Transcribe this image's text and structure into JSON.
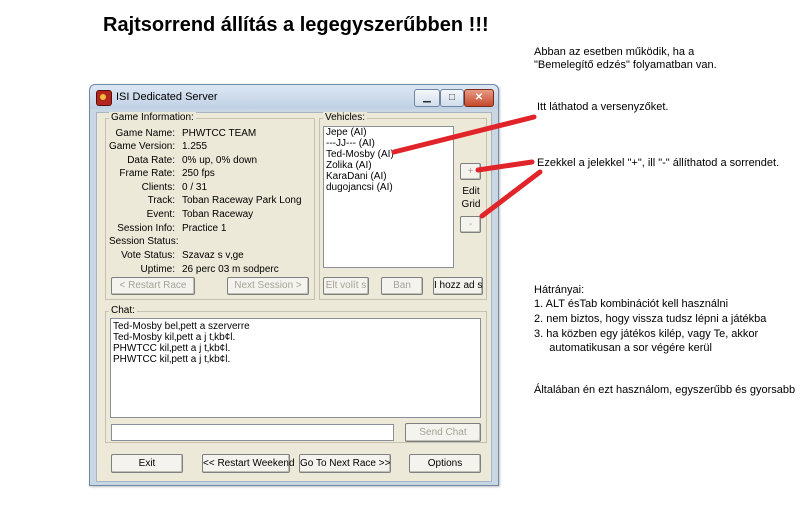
{
  "headline": "Rajtsorrend állítás a legegyszerűbben !!!",
  "notes": {
    "top_1": "Abban az esetben működik, ha a",
    "top_2": " \"Bemelegítő edzés\" folyamatban van.",
    "vehicles_hint": "Itt láthatod a versenyzőket.",
    "buttons_hint": "Ezekkel a jelekkel \"+\", ill \"-\" állíthatod a sorrendet.",
    "drawbacks_title": "Hátrányai:",
    "drawbacks": [
      "1. ALT ésTab kombinációt kell használni",
      "2. nem biztos, hogy vissza tudsz lépni a játékba",
      "3. ha közben egy játékos kilép, vagy Te, akkor",
      "     automatikusan a sor végére kerül"
    ],
    "summary": "Általában én ezt használom, egyszerűbb és gyorsabb"
  },
  "colors": {
    "marker": "#e0242a",
    "window_frame": "#c9d6e4",
    "dialog_face": "#ece9d8"
  },
  "window": {
    "title": "ISI Dedicated Server",
    "icon": "isi-app-icon",
    "controls": {
      "minimize": "▁",
      "maximize": "□",
      "close": "✕"
    }
  },
  "game_info": {
    "group_label": "Game Information:",
    "rows": [
      {
        "label": "Game Name:",
        "value": "PHWTCC TEAM"
      },
      {
        "label": "Game Version:",
        "value": "1.255"
      },
      {
        "label": "Data Rate:",
        "value": "0% up, 0% down"
      },
      {
        "label": "Frame Rate:",
        "value": "250 fps"
      },
      {
        "label": "Clients:",
        "value": "0 / 31"
      },
      {
        "label": "Track:",
        "value": "Toban Raceway Park Long"
      },
      {
        "label": "Event:",
        "value": "Toban Raceway"
      },
      {
        "label": "Session Info:",
        "value": "Practice 1"
      },
      {
        "label": "Session Status:",
        "value": ""
      },
      {
        "label": "Vote Status:",
        "value": "Szavaz s v‚ge"
      },
      {
        "label": "Uptime:",
        "value": "26 perc 03 m sodperc"
      }
    ],
    "restart_race": "< Restart Race",
    "next_session": "Next Session >"
  },
  "vehicles": {
    "group_label": "Vehicles:",
    "items": [
      "Jepe (AI)",
      "---JJ--- (AI)",
      "Ted-Mosby (AI)",
      "Zolika (AI)",
      "KaraDani (AI)",
      "dugojancsi (AI)"
    ],
    "plus": "+",
    "edit_grid_1": "Edit",
    "edit_grid_2": "Grid",
    "minus": "-",
    "kick": "Elt volít s",
    "ban": "Ban",
    "add_ai": "I hozz ad s"
  },
  "chat": {
    "label": "Chat:",
    "lines": [
      "Ted-Mosby bel‚pett a szerverre",
      "Ted-Mosby kil‚pett a j t‚kb¢l.",
      "PHWTCC kil‚pett a j t‚kb¢l.",
      "PHWTCC kil‚pett a j t‚kb¢l."
    ],
    "input_value": "",
    "send": "Send Chat"
  },
  "bottom": {
    "exit": "Exit",
    "restart_weekend": "<< Restart Weekend",
    "next_race": "Go To Next Race >>",
    "options": "Options"
  }
}
